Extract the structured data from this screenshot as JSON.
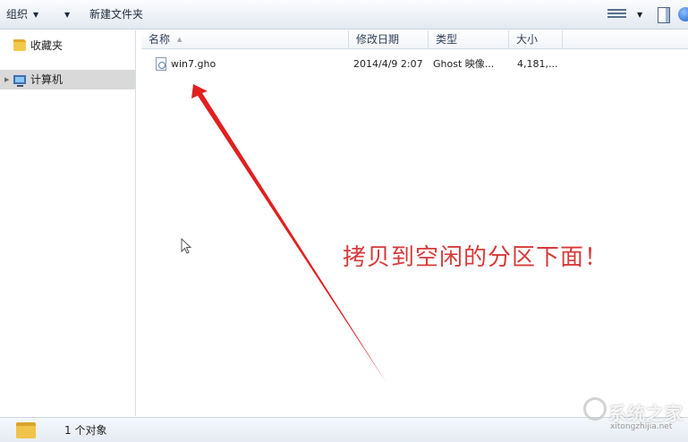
{
  "toolbar": {
    "organize_label": "组织",
    "new_folder_label": "新建文件夹"
  },
  "navigation": {
    "favorites_label": "收藏夹",
    "computer_label": "计算机"
  },
  "columns": {
    "name": "名称",
    "date_modified": "修改日期",
    "type": "类型",
    "size": "大小"
  },
  "files": [
    {
      "name": "win7.gho",
      "date_modified": "2014/4/9 2:07",
      "type": "Ghost 映像...",
      "size": "4,181,..."
    }
  ],
  "annotation": {
    "text": "拷贝到空闲的分区下面！",
    "color": "#d83a3a"
  },
  "status": {
    "item_count": "1 个对象"
  },
  "watermark": {
    "text": "系统之家",
    "url": "xitongzhijia.net"
  },
  "icons": {
    "organize": "dropdown-icon",
    "favorites": "star-folder-icon",
    "computer": "computer-icon",
    "file": "gho-file-icon",
    "status": "folder-icon",
    "view": "view-options-icon",
    "pane": "preview-pane-icon",
    "help": "help-icon"
  }
}
